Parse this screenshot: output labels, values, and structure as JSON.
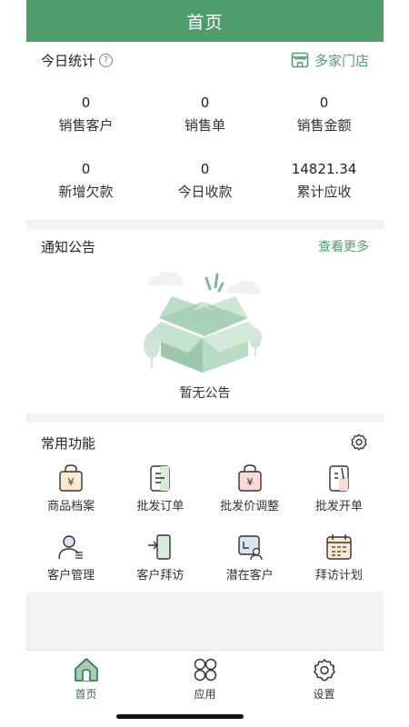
{
  "header": {
    "title": "首页"
  },
  "stats": {
    "title": "今日统计",
    "store_link": "多家门店",
    "items": [
      {
        "value": "0",
        "label": "销售客户"
      },
      {
        "value": "0",
        "label": "销售单"
      },
      {
        "value": "0",
        "label": "销售金额"
      },
      {
        "value": "0",
        "label": "新增欠款"
      },
      {
        "value": "0",
        "label": "今日收款"
      },
      {
        "value": "14821.34",
        "label": "累计应收"
      }
    ]
  },
  "notice": {
    "title": "通知公告",
    "more_link": "查看更多",
    "empty_text": "暂无公告"
  },
  "functions": {
    "title": "常用功能",
    "items": [
      {
        "label": "商品档案",
        "icon": "shopping-bag-yuan-icon"
      },
      {
        "label": "批发订单",
        "icon": "clipboard-icon"
      },
      {
        "label": "批发价调整",
        "icon": "price-tag-yuan-icon"
      },
      {
        "label": "批发开单",
        "icon": "document-edit-icon"
      },
      {
        "label": "客户管理",
        "icon": "customer-icon"
      },
      {
        "label": "客户拜访",
        "icon": "door-enter-icon"
      },
      {
        "label": "潜在客户",
        "icon": "potential-customer-icon"
      },
      {
        "label": "拜访计划",
        "icon": "calendar-icon"
      }
    ]
  },
  "tabbar": {
    "items": [
      {
        "label": "首页",
        "icon": "home-icon",
        "active": true
      },
      {
        "label": "应用",
        "icon": "apps-icon",
        "active": false
      },
      {
        "label": "设置",
        "icon": "settings-icon",
        "active": false
      }
    ]
  },
  "colors": {
    "brand": "#4f9c6d",
    "brand_dark": "#2f6e4b",
    "background": "#f2f2f2"
  }
}
